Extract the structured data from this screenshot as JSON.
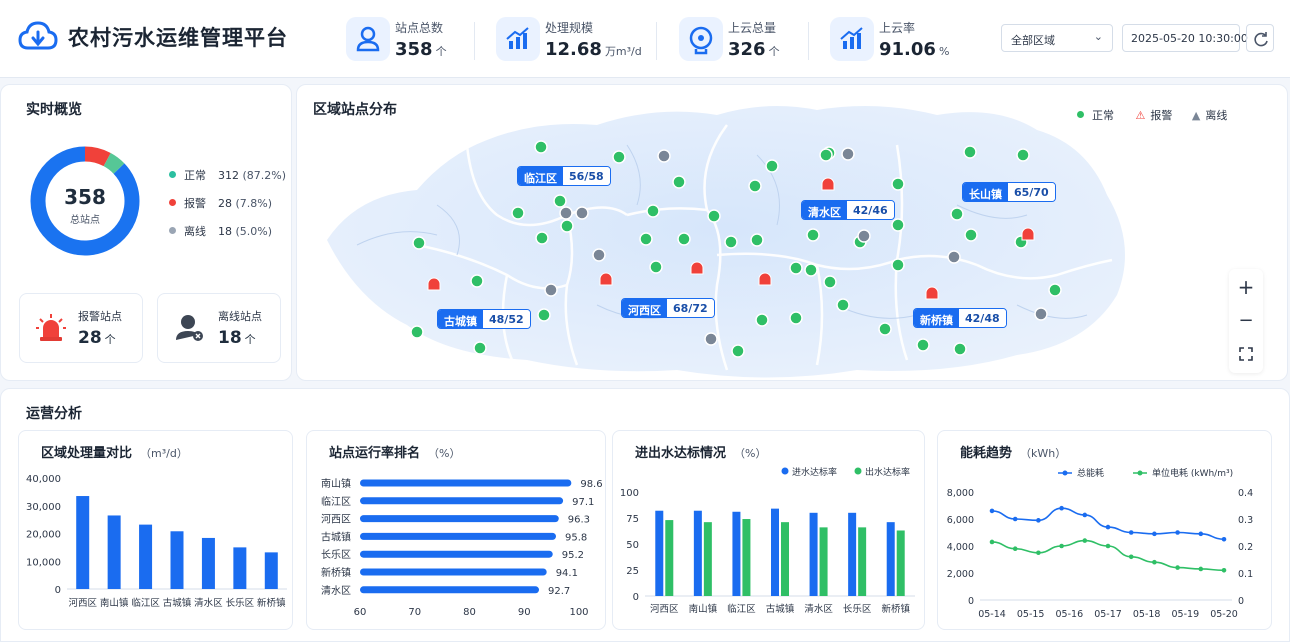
{
  "header": {
    "title": "农村污水运维管理平台",
    "kpis": [
      {
        "label": "站点总数",
        "value": "358",
        "unit": "个"
      },
      {
        "label": "处理规模",
        "value": "12.68",
        "unit": "万m³/d"
      },
      {
        "label": "上云总量",
        "value": "326",
        "unit": "个"
      },
      {
        "label": "上云率",
        "value": "91.06",
        "unit": "%"
      }
    ],
    "region_select": "全部区域",
    "datetime": "2025-05-20 10:30:00"
  },
  "overview": {
    "title": "实时概览",
    "total": "358",
    "total_label": "总站点",
    "legend": [
      {
        "label": "正常",
        "count": "312",
        "pct": "(87.2%)",
        "value": 312,
        "color": "#1a73f0"
      },
      {
        "label": "报警",
        "count": "28",
        "pct": "(7.8%)",
        "value": 28,
        "color": "#f0413a"
      },
      {
        "label": "离线",
        "count": "18",
        "pct": "(5.0%)",
        "value": 18,
        "color": "#56c796"
      }
    ],
    "alarm_card": {
      "label": "报警站点",
      "value": "28",
      "unit": "个"
    },
    "offline_card": {
      "label": "离线站点",
      "value": "18",
      "unit": "个"
    }
  },
  "map": {
    "title": "区域站点分布",
    "legend": {
      "normal": "正常",
      "alarm": "报警",
      "offline": "离线"
    },
    "regions": [
      {
        "name": "临江区",
        "count": "56/58"
      },
      {
        "name": "清水区",
        "count": "42/46"
      },
      {
        "name": "长山镇",
        "count": "65/70"
      },
      {
        "name": "古城镇",
        "count": "48/52"
      },
      {
        "name": "河西区",
        "count": "68/72"
      },
      {
        "name": "新桥镇",
        "count": "42/48"
      }
    ],
    "zoom_in": "+",
    "zoom_out": "−"
  },
  "ops": {
    "title": "运营分析"
  },
  "chart_data": [
    {
      "type": "bar",
      "title": "区域处理量对比",
      "unit": "（m³/d）",
      "categories": [
        "河西区",
        "南山镇",
        "临江区",
        "古城镇",
        "清水区",
        "长乐区",
        "新桥镇"
      ],
      "values": [
        33500,
        26500,
        23200,
        20800,
        18400,
        15000,
        13200
      ],
      "ylim": [
        0,
        40000
      ],
      "yticks": [
        "0",
        "10,000",
        "20,000",
        "30,000",
        "40,000"
      ],
      "color": "#1a6cf0"
    },
    {
      "type": "bar",
      "orientation": "horizontal",
      "title": "站点运行率排名",
      "unit": "（%）",
      "categories": [
        "南山镇",
        "临江区",
        "河西区",
        "古城镇",
        "长乐区",
        "新桥镇",
        "清水区"
      ],
      "values": [
        98.6,
        97.1,
        96.3,
        95.8,
        95.2,
        94.1,
        92.7
      ],
      "labels": [
        "98.6",
        "97.1",
        "96.3",
        "95.8",
        "95.2",
        "94.1",
        "92.7"
      ],
      "xlim": [
        60,
        100
      ],
      "xticks": [
        "60",
        "70",
        "80",
        "90",
        "100"
      ],
      "color": "#1a6cf0"
    },
    {
      "type": "bar",
      "title": "进出水达标情况",
      "unit": "（%）",
      "categories": [
        "河西区",
        "南山镇",
        "临江区",
        "古城镇",
        "清水区",
        "长乐区",
        "新桥镇"
      ],
      "series": [
        {
          "name": "进水达标率",
          "values": [
            82,
            82,
            81,
            84,
            80,
            80,
            71
          ],
          "color": "#1a6cf0"
        },
        {
          "name": "出水达标率",
          "values": [
            73,
            71,
            74,
            71,
            66,
            66,
            63
          ],
          "color": "#2fbf66"
        }
      ],
      "ylim": [
        0,
        100
      ],
      "yticks": [
        "0",
        "25",
        "50",
        "75",
        "100"
      ]
    },
    {
      "type": "line",
      "title": "能耗趋势",
      "unit": "（kWh）",
      "categories": [
        "05-14",
        "05-15",
        "05-16",
        "05-17",
        "05-18",
        "05-19",
        "05-20"
      ],
      "series": [
        {
          "name": "总能耗",
          "axis": "left",
          "values": [
            6600,
            6000,
            5900,
            6800,
            6300,
            5400,
            5000,
            4900,
            5000,
            4900,
            4500
          ],
          "color": "#1a6cf0"
        },
        {
          "name": "单位电耗 (kWh/m³)",
          "axis": "right",
          "values": [
            0.215,
            0.19,
            0.175,
            0.2,
            0.22,
            0.2,
            0.16,
            0.14,
            0.12,
            0.115,
            0.11
          ],
          "color": "#2fbf66"
        }
      ],
      "ylim": [
        0,
        8000
      ],
      "yticks": [
        "0",
        "2,000",
        "4,000",
        "6,000",
        "8,000"
      ],
      "y2lim": [
        0,
        0.4
      ],
      "y2ticks": [
        "0",
        "0.1",
        "0.2",
        "0.3",
        "0.4"
      ]
    }
  ]
}
